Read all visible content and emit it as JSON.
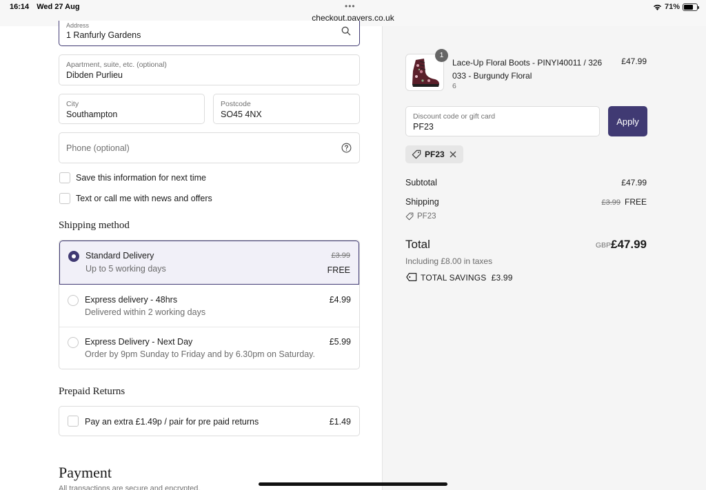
{
  "status_bar": {
    "time": "16:14",
    "date": "Wed 27 Aug",
    "url": "checkout.pavers.co.uk",
    "battery": "71%",
    "battery_level": 0.71
  },
  "form": {
    "address": {
      "label": "Address",
      "value": "1 Ranfurly Gardens"
    },
    "apartment": {
      "label": "Apartment, suite, etc. (optional)",
      "value": "Dibden Purlieu"
    },
    "city": {
      "label": "City",
      "value": "Southampton"
    },
    "postcode": {
      "label": "Postcode",
      "value": "SO45 4NX"
    },
    "phone": {
      "placeholder": "Phone (optional)"
    },
    "save_info_label": "Save this information for next time",
    "news_label": "Text or call me with news and offers"
  },
  "shipping": {
    "title": "Shipping method",
    "options": [
      {
        "title": "Standard Delivery",
        "subtitle": "Up to 5 working days",
        "original_price": "£3.99",
        "price": "FREE",
        "selected": true
      },
      {
        "title": "Express delivery - 48hrs",
        "subtitle": "Delivered within 2 working days",
        "price": "£4.99",
        "selected": false
      },
      {
        "title": "Express Delivery - Next Day",
        "subtitle": "Order by 9pm Sunday to Friday and by 6.30pm on Saturday.",
        "price": "£5.99",
        "selected": false
      }
    ]
  },
  "returns": {
    "title": "Prepaid Returns",
    "option_label": "Pay an extra £1.49p / pair for pre paid returns",
    "price": "£1.49"
  },
  "payment": {
    "title": "Payment",
    "subtitle": "All transactions are secure and encrypted."
  },
  "summary": {
    "product": {
      "quantity": "1",
      "name": "Lace-Up Floral Boots - PINYI40011 / 326 033 - Burgundy Floral",
      "size": "6",
      "price": "£47.99"
    },
    "discount": {
      "label": "Discount code or gift card",
      "value": "PF23",
      "apply_label": "Apply",
      "applied_code": "PF23"
    },
    "subtotal_label": "Subtotal",
    "subtotal_value": "£47.99",
    "shipping_label": "Shipping",
    "shipping_original": "£3.99",
    "shipping_value": "FREE",
    "shipping_code": "PF23",
    "total_label": "Total",
    "total_currency": "GBP",
    "total_value": "£47.99",
    "tax_note": "Including £8.00 in taxes",
    "savings": "TOTAL SAVINGS  £3.99"
  },
  "colors": {
    "accent": "#403a73",
    "summary_background": "#f5f5f5",
    "selected_option_background": "#f1f0f8"
  },
  "icons": [
    "wifi-icon",
    "battery-icon",
    "search-icon",
    "help-circle-icon",
    "tag-icon",
    "close-icon",
    "savings-tag-icon"
  ]
}
